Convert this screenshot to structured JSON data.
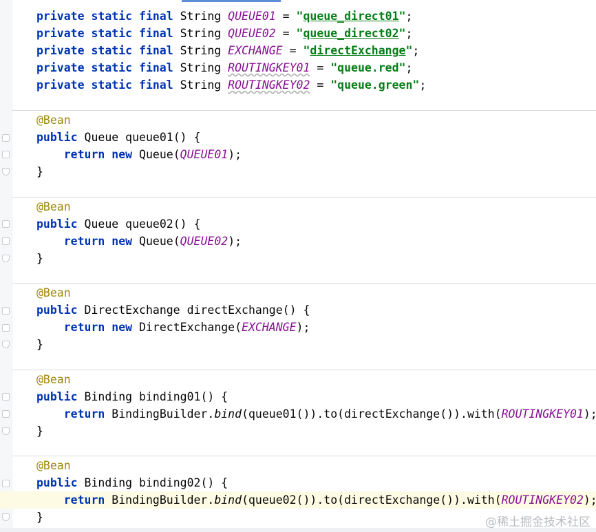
{
  "fields": [
    {
      "mods": "private static final",
      "type": "String",
      "name": "QUEUE01",
      "value": "queue_direct01"
    },
    {
      "mods": "private static final",
      "type": "String",
      "name": "QUEUE02",
      "value": "queue_direct02"
    },
    {
      "mods": "private static final",
      "type": "String",
      "name": "EXCHANGE",
      "value": "directExchange"
    },
    {
      "mods": "private static final",
      "type": "String",
      "name": "ROUTINGKEY01",
      "value": "queue.red"
    },
    {
      "mods": "private static final",
      "type": "String",
      "name": "ROUTINGKEY02",
      "value": "queue.green"
    }
  ],
  "methods": [
    {
      "annotation": "@Bean",
      "public": "public",
      "ret_type": "Queue",
      "name": "queue01",
      "ret_kw": "return",
      "new_kw": "new",
      "ctor": "Queue",
      "arg": "QUEUE01"
    },
    {
      "annotation": "@Bean",
      "public": "public",
      "ret_type": "Queue",
      "name": "queue02",
      "ret_kw": "return",
      "new_kw": "new",
      "ctor": "Queue",
      "arg": "QUEUE02"
    },
    {
      "annotation": "@Bean",
      "public": "public",
      "ret_type": "DirectExchange",
      "name": "directExchange",
      "ret_kw": "return",
      "new_kw": "new",
      "ctor": "DirectExchange",
      "arg": "EXCHANGE"
    },
    {
      "annotation": "@Bean",
      "public": "public",
      "ret_type": "Binding",
      "name": "binding01",
      "ret_kw": "return",
      "builder": "BindingBuilder",
      "bind": "bind",
      "bind_arg": "queue01",
      "to": "to",
      "to_arg": "directExchange",
      "with": "with",
      "with_arg": "ROUTINGKEY01"
    },
    {
      "annotation": "@Bean",
      "public": "public",
      "ret_type": "Binding",
      "name": "binding02",
      "ret_kw": "return",
      "builder": "BindingBuilder",
      "bind": "bind",
      "bind_arg": "queue02",
      "to": "to",
      "to_arg": "directExchange",
      "with": "with",
      "with_arg": "ROUTINGKEY02"
    }
  ],
  "watermark": "@稀土掘金技术社区"
}
